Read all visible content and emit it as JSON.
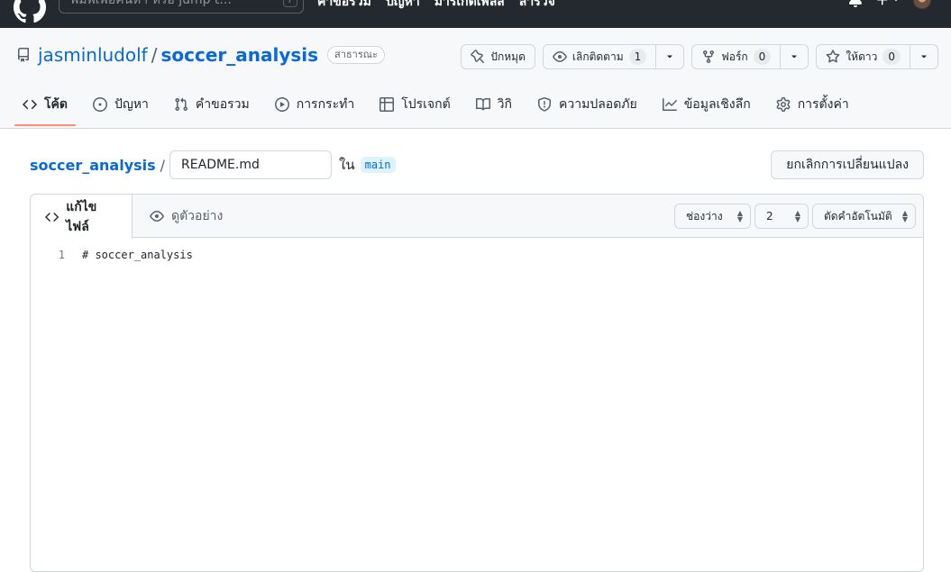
{
  "topbar": {
    "search_placeholder": "พิมพ์เพื่อค้นหา หรือ jump t...",
    "search_slash": "/",
    "nav": [
      "คำขอรวม",
      "ปัญหา",
      "มาร์เก็ตเพลส",
      "สำรวจ"
    ]
  },
  "repo": {
    "owner": "jasminludolf",
    "separator": "/",
    "name": "soccer_analysis",
    "visibility": "สาธารณะ",
    "pin_label": "ปักหมุด",
    "watch_label": "เลิกติดตาม",
    "watch_count": "1",
    "fork_label": "ฟอร์ก",
    "fork_count": "0",
    "star_label": "ให้ดาว",
    "star_count": "0"
  },
  "tabs": [
    {
      "label": "โค้ด",
      "icon": "code-icon",
      "active": true
    },
    {
      "label": "ปัญหา",
      "icon": "issue-icon"
    },
    {
      "label": "คำขอรวม",
      "icon": "pull-request-icon"
    },
    {
      "label": "การกระทำ",
      "icon": "play-icon"
    },
    {
      "label": "โปรเจกต์",
      "icon": "table-icon"
    },
    {
      "label": "วิกิ",
      "icon": "book-icon"
    },
    {
      "label": "ความปลอดภัย",
      "icon": "shield-icon"
    },
    {
      "label": "ข้อมูลเชิงลึก",
      "icon": "graph-icon"
    },
    {
      "label": "การตั้งค่า",
      "icon": "gear-icon"
    }
  ],
  "path": {
    "repo_crumb": "soccer_analysis",
    "slash": "/",
    "filename": "README.md",
    "in_label": "ใน",
    "branch": "main",
    "cancel_label": "ยกเลิกการเปลี่ยนแปลง"
  },
  "editor": {
    "edit_tab": "แก้ไขไฟล์",
    "preview_tab": "ดูตัวอย่าง",
    "indent_mode": "ช่องว่าง",
    "indent_size": "2",
    "wrap_mode": "ตัดคำอัตโนมัติ",
    "lines": [
      {
        "number": "1",
        "text": "# soccer_analysis"
      }
    ]
  }
}
